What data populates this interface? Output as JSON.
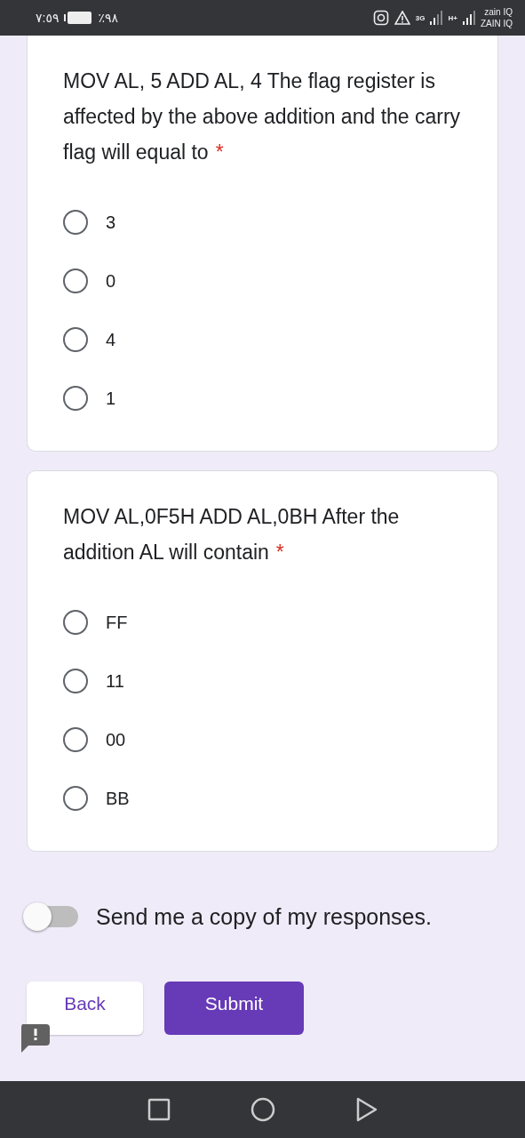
{
  "status_bar": {
    "time": "٧:٥٩",
    "battery": "٪٩٨",
    "network_1": "3G",
    "network_2": "H+",
    "carrier_1": "zain IQ",
    "carrier_2": "ZAIN IQ"
  },
  "questions": [
    {
      "text": "MOV AL, 5 ADD AL, 4 The flag register is affected by the above addition and the carry flag will equal to",
      "required_mark": "*",
      "options": [
        {
          "label": "3",
          "selected": false
        },
        {
          "label": "0",
          "selected": false
        },
        {
          "label": "4",
          "selected": false
        },
        {
          "label": "1",
          "selected": false
        }
      ]
    },
    {
      "text": "MOV AL,0F5H ADD AL,0BH After the addition AL will contain",
      "required_mark": "*",
      "options": [
        {
          "label": "FF",
          "selected": false
        },
        {
          "label": "11",
          "selected": false
        },
        {
          "label": "00",
          "selected": false
        },
        {
          "label": "BB",
          "selected": false
        }
      ]
    }
  ],
  "copy_toggle": {
    "label": "Send me a copy of my responses.",
    "on": false
  },
  "buttons": [
    {
      "label": "Back",
      "kind": "secondary"
    },
    {
      "label": "Submit",
      "kind": "primary"
    }
  ]
}
